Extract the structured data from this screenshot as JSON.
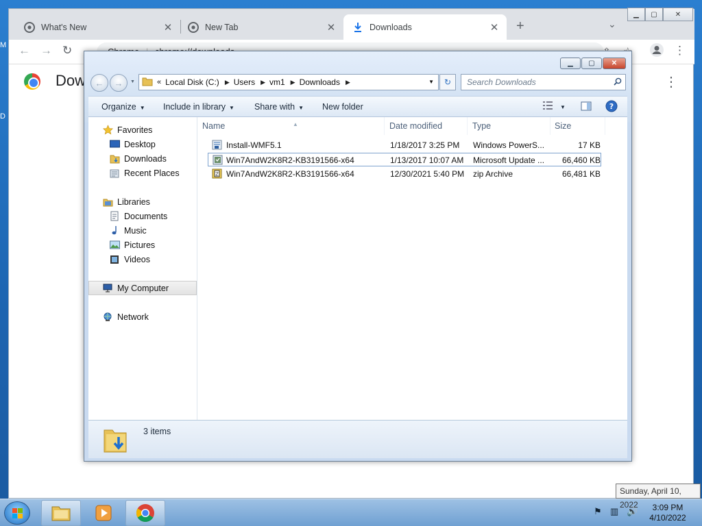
{
  "desktop": {
    "letters": [
      "M",
      "D"
    ]
  },
  "chrome": {
    "tabs": [
      {
        "label": "What's New"
      },
      {
        "label": "New Tab"
      },
      {
        "label": "Downloads"
      }
    ],
    "omnibox": {
      "site_chip": "Chrome",
      "url": "chrome://downloads"
    },
    "page_title": "Dow"
  },
  "explorer": {
    "breadcrumb": [
      "Local Disk (C:)",
      "Users",
      "vm1",
      "Downloads"
    ],
    "search_placeholder": "Search Downloads",
    "commands": {
      "organize": "Organize",
      "include_in_library": "Include in library",
      "share_with": "Share with",
      "new_folder": "New folder"
    },
    "nav": {
      "favorites": "Favorites",
      "desktop": "Desktop",
      "downloads": "Downloads",
      "recent_places": "Recent Places",
      "libraries": "Libraries",
      "documents": "Documents",
      "music": "Music",
      "pictures": "Pictures",
      "videos": "Videos",
      "my_computer": "My Computer",
      "network": "Network"
    },
    "columns": {
      "name": "Name",
      "date_modified": "Date modified",
      "type": "Type",
      "size": "Size"
    },
    "files": [
      {
        "name": "Install-WMF5.1",
        "date": "1/18/2017 3:25 PM",
        "type": "Windows PowerS...",
        "size": "17 KB"
      },
      {
        "name": "Win7AndW2K8R2-KB3191566-x64",
        "date": "1/13/2017 10:07 AM",
        "type": "Microsoft Update ...",
        "size": "66,460 KB"
      },
      {
        "name": "Win7AndW2K8R2-KB3191566-x64",
        "date": "12/30/2021 5:40 PM",
        "type": "zip Archive",
        "size": "66,481 KB"
      }
    ],
    "status": "3 items"
  },
  "taskbar": {
    "time": "3:09 PM",
    "date": "4/10/2022",
    "tooltip": "Sunday, April 10, 2022"
  }
}
